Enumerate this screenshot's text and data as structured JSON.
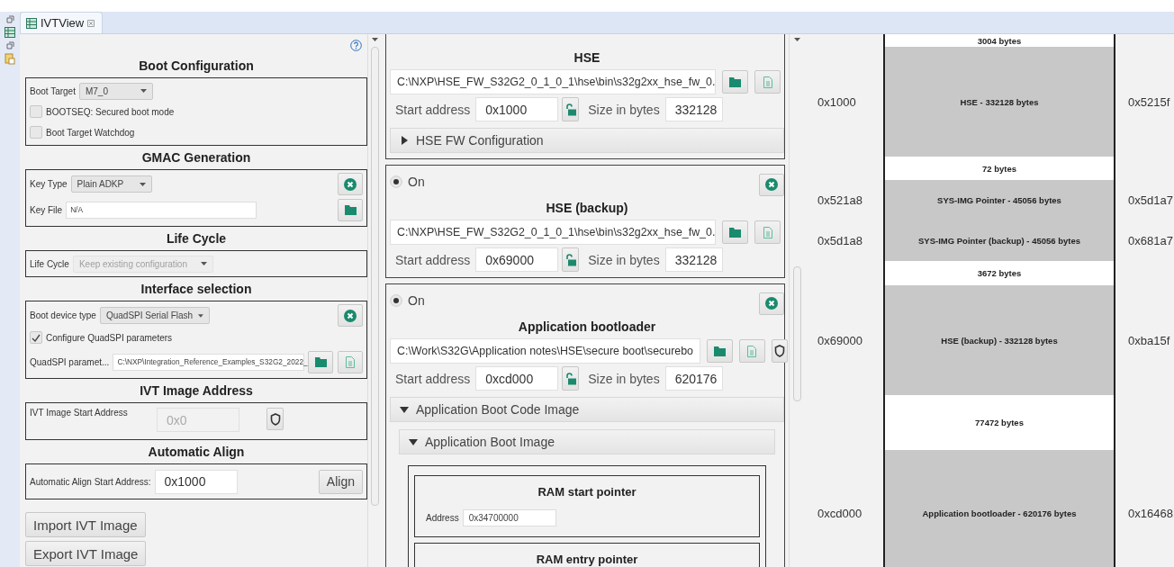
{
  "tab": {
    "label": "IVTView",
    "selected": true
  },
  "left_panel": {
    "sections": [
      {
        "title": "Boot Configuration",
        "removable": false,
        "rows": [
          {
            "kind": "dropdown",
            "label": "Boot Target",
            "value": "M7_0",
            "disabled": false
          },
          {
            "kind": "checkbox",
            "label": "BOOTSEQ: Secured boot mode",
            "checked": false
          },
          {
            "kind": "checkbox",
            "label": "Boot Target Watchdog",
            "checked": false
          }
        ]
      },
      {
        "title": "GMAC Generation",
        "removable": true,
        "rows": [
          {
            "kind": "dropdown",
            "label": "Key Type",
            "value": "Plain ADKP",
            "disabled": false
          },
          {
            "kind": "file",
            "label": "Key File",
            "value": "N/A",
            "disabled": false,
            "actions": [
              {
                "kind": "folder"
              }
            ]
          }
        ]
      },
      {
        "title": "Life Cycle",
        "removable": false,
        "rows": [
          {
            "kind": "dropdown",
            "label": "Life Cycle",
            "value": "Keep existing configuration",
            "disabled": true
          }
        ]
      },
      {
        "title": "Interface selection",
        "removable": true,
        "rows": [
          {
            "kind": "dropdown",
            "label": "Boot device type",
            "value": "QuadSPI Serial Flash",
            "disabled": false
          },
          {
            "kind": "checkbox",
            "label": "Configure QuadSPI parameters",
            "checked": true
          },
          {
            "kind": "file",
            "label": "QuadSPI paramet...",
            "value": "C:\\NXP\\Integration_Reference_Examples_S32G2_2022_",
            "disabled": false,
            "actions": [
              {
                "kind": "folder"
              },
              {
                "kind": "document"
              }
            ]
          }
        ]
      },
      {
        "title": "IVT Image Address",
        "removable": false,
        "rows": [
          {
            "kind": "address",
            "label": "IVT Image Start Address",
            "value": "0x0",
            "disabled": true,
            "actions": [
              {
                "kind": "shield"
              }
            ]
          }
        ]
      },
      {
        "title": "Automatic Align",
        "removable": false,
        "rows": [
          {
            "kind": "align",
            "label": "Automatic Align Start Address:",
            "value": "0x1000",
            "disabled": false,
            "button": "Align"
          }
        ]
      }
    ],
    "buttons": [
      "Import IVT Image",
      "Export IVT Image"
    ]
  },
  "images": [
    {
      "title": "HSE",
      "path": "C:\\NXP\\HSE_FW_S32G2_0_1_0_1\\hse\\bin\\s32g2xx_hse_fw_0.",
      "actions": [
        {
          "kind": "folder"
        },
        {
          "kind": "document"
        }
      ],
      "start_label": "Start address",
      "start_address": "0x1000",
      "size_label": "Size in bytes",
      "size": "332128",
      "expanders": [
        {
          "label": "HSE FW Configuration",
          "expanded": false
        }
      ]
    },
    {
      "toggle": {
        "label": "On",
        "selected": true
      },
      "title": "HSE (backup)",
      "path": "C:\\NXP\\HSE_FW_S32G2_0_1_0_1\\hse\\bin\\s32g2xx_hse_fw_0.",
      "actions": [
        {
          "kind": "folder"
        },
        {
          "kind": "document"
        }
      ],
      "start_label": "Start address",
      "start_address": "0x69000",
      "size_label": "Size in bytes",
      "size": "332128"
    },
    {
      "toggle": {
        "label": "On",
        "selected": true
      },
      "title": "Application bootloader",
      "path": "C:\\Work\\S32G\\Application notes\\HSE\\secure boot\\securebo",
      "actions": [
        {
          "kind": "folder"
        },
        {
          "kind": "document"
        },
        {
          "kind": "shield"
        }
      ],
      "start_label": "Start address",
      "start_address": "0xcd000",
      "size_label": "Size in bytes",
      "size": "620176",
      "expanders": [
        {
          "label": "Application Boot Code Image",
          "expanded": true,
          "children": [
            {
              "label": "Application Boot Image",
              "expanded": true,
              "pointers": [
                {
                  "title": "RAM start pointer",
                  "address_label": "Address",
                  "address": "0x34700000"
                },
                {
                  "title": "RAM entry pointer"
                }
              ]
            }
          ]
        }
      ]
    }
  ],
  "memory_map": {
    "rows": [
      {
        "kind": "free",
        "label": "3004 bytes"
      },
      {
        "kind": "used",
        "start": "0x1000",
        "label": "HSE - 332128 bytes",
        "end": "0x5215f"
      },
      {
        "kind": "free",
        "label": "72 bytes"
      },
      {
        "kind": "used",
        "start": "0x521a8",
        "label": "SYS-IMG Pointer - 45056 bytes",
        "end": "0x5d1a7"
      },
      {
        "kind": "used",
        "start": "0x5d1a8",
        "label": "SYS-IMG Pointer (backup) - 45056 bytes",
        "end": "0x681a7"
      },
      {
        "kind": "free",
        "label": "3672 bytes"
      },
      {
        "kind": "used",
        "start": "0x69000",
        "label": "HSE (backup) - 332128 bytes",
        "end": "0xba15f"
      },
      {
        "kind": "free",
        "label": "77472 bytes"
      },
      {
        "kind": "used",
        "start": "0xcd000",
        "label": "Application bootloader - 620176 bytes",
        "end": "0x16468"
      }
    ]
  }
}
